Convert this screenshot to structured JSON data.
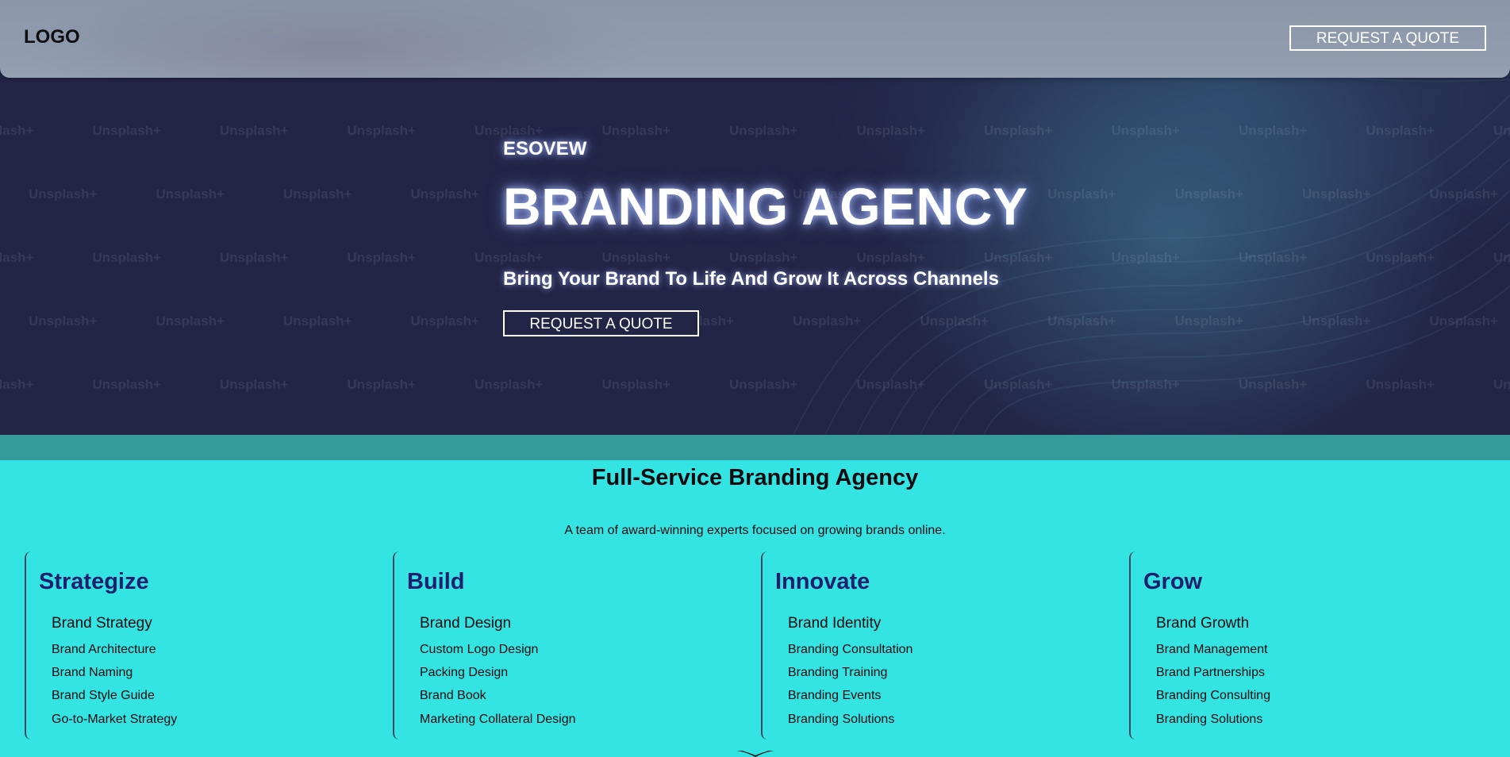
{
  "header": {
    "logo": "LOGO",
    "cta_label": "REQUEST A QUOTE"
  },
  "hero": {
    "eyebrow": "ESOVEW",
    "title": "BRANDING AGENCY",
    "subtitle": "Bring Your Brand To Life And Grow It Across Channels",
    "cta_label": "REQUEST A QUOTE",
    "watermark_text": "Unsplash+"
  },
  "services": {
    "title": "Full-Service Branding Agency",
    "description": "A team of award-winning experts focused on growing brands online.",
    "columns": [
      {
        "title": "Strategize",
        "lead": "Brand Strategy",
        "items": [
          "Brand Architecture",
          "Brand Naming",
          "Brand Style Guide",
          "Go-to-Market Strategy"
        ]
      },
      {
        "title": "Build",
        "lead": "Brand Design",
        "items": [
          "Custom Logo Design",
          "Packing Design",
          "Brand Book",
          "Marketing Collateral Design"
        ]
      },
      {
        "title": "Innovate",
        "lead": "Brand Identity",
        "items": [
          "Branding Consultation",
          "Branding Training",
          "Branding Events",
          "Branding Solutions"
        ]
      },
      {
        "title": "Grow",
        "lead": "Brand Growth",
        "items": [
          "Brand Management",
          "Brand Partnerships",
          "Branding Consulting",
          "Branding Solutions"
        ]
      }
    ]
  },
  "colors": {
    "hero_bg": "#222546",
    "header_bg": "#909cae",
    "strip": "#349a9a",
    "section_bg": "#34e4e2",
    "column_title": "#1c1f6e"
  }
}
